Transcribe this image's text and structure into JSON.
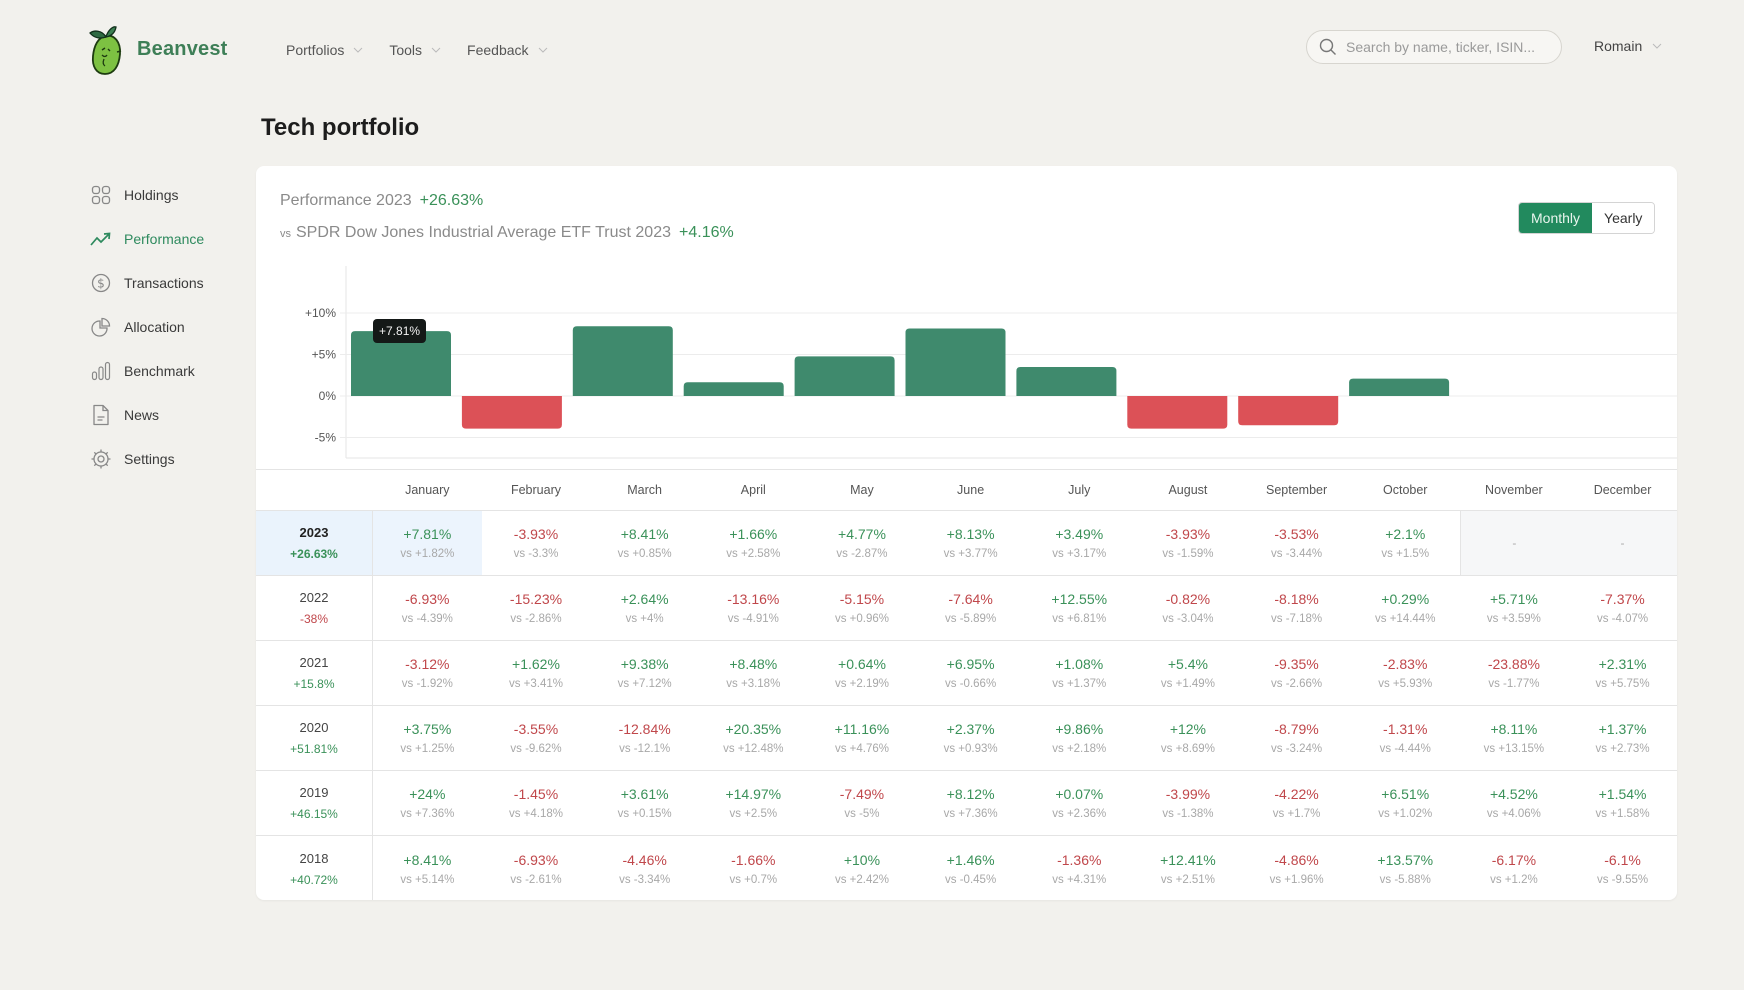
{
  "header": {
    "brand": "Beanvest",
    "nav": [
      {
        "label": "Portfolios"
      },
      {
        "label": "Tools"
      },
      {
        "label": "Feedback"
      }
    ],
    "search_placeholder": "Search by name, ticker, ISIN...",
    "user": "Romain"
  },
  "sidebar": {
    "items": [
      {
        "label": "Holdings",
        "icon": "grid-icon",
        "active": false
      },
      {
        "label": "Performance",
        "icon": "trending-up-icon",
        "active": true
      },
      {
        "label": "Transactions",
        "icon": "dollar-circle-icon",
        "active": false
      },
      {
        "label": "Allocation",
        "icon": "pie-chart-icon",
        "active": false
      },
      {
        "label": "Benchmark",
        "icon": "bar-chart-icon",
        "active": false
      },
      {
        "label": "News",
        "icon": "document-icon",
        "active": false
      },
      {
        "label": "Settings",
        "icon": "gear-icon",
        "active": false
      }
    ]
  },
  "page_title": "Tech portfolio",
  "summary": {
    "perf_label": "Performance 2023",
    "perf_value": "+26.63%",
    "vs_label": "vs",
    "benchmark_label": "SPDR Dow Jones Industrial Average ETF Trust 2023",
    "benchmark_value": "+4.16%"
  },
  "toggle": {
    "options": [
      "Monthly",
      "Yearly"
    ],
    "selected": "Monthly"
  },
  "colors": {
    "positive": "#3a9159",
    "negative": "#c0474b",
    "bar_positive": "#3f8a6d",
    "bar_negative": "#dc5157",
    "accent": "#228a5e"
  },
  "tooltip": {
    "month": "January",
    "text": "+7.81%"
  },
  "chart_data": {
    "type": "bar",
    "title": "Performance 2023",
    "categories": [
      "January",
      "February",
      "March",
      "April",
      "May",
      "June",
      "July",
      "August",
      "September",
      "October",
      "November",
      "December"
    ],
    "values": [
      7.81,
      -3.93,
      8.41,
      1.66,
      4.77,
      8.13,
      3.49,
      -3.93,
      -3.53,
      2.1,
      null,
      null
    ],
    "yticks": [
      "+10%",
      "+5%",
      "0%",
      "-5%"
    ],
    "ytick_values": [
      10,
      5,
      0,
      -5
    ],
    "ylim": [
      -7.5,
      12.5
    ],
    "xlabel": "",
    "ylabel": "",
    "grid": true,
    "legend": "none"
  },
  "table": {
    "months": [
      "January",
      "February",
      "March",
      "April",
      "May",
      "June",
      "July",
      "August",
      "September",
      "October",
      "November",
      "December"
    ],
    "rows": [
      {
        "year": "2023",
        "total": "+26.63%",
        "current": true,
        "cells": [
          {
            "v": "+7.81%",
            "b": "vs +1.82%"
          },
          {
            "v": "-3.93%",
            "b": "vs -3.3%"
          },
          {
            "v": "+8.41%",
            "b": "vs +0.85%"
          },
          {
            "v": "+1.66%",
            "b": "vs +2.58%"
          },
          {
            "v": "+4.77%",
            "b": "vs -2.87%"
          },
          {
            "v": "+8.13%",
            "b": "vs +3.77%"
          },
          {
            "v": "+3.49%",
            "b": "vs +3.17%"
          },
          {
            "v": "-3.93%",
            "b": "vs -1.59%"
          },
          {
            "v": "-3.53%",
            "b": "vs -3.44%"
          },
          {
            "v": "+2.1%",
            "b": "vs +1.5%"
          },
          {
            "v": "-",
            "b": null
          },
          {
            "v": "-",
            "b": null
          }
        ]
      },
      {
        "year": "2022",
        "total": "-38%",
        "current": false,
        "cells": [
          {
            "v": "-6.93%",
            "b": "vs -4.39%"
          },
          {
            "v": "-15.23%",
            "b": "vs -2.86%"
          },
          {
            "v": "+2.64%",
            "b": "vs +4%"
          },
          {
            "v": "-13.16%",
            "b": "vs -4.91%"
          },
          {
            "v": "-5.15%",
            "b": "vs +0.96%"
          },
          {
            "v": "-7.64%",
            "b": "vs -5.89%"
          },
          {
            "v": "+12.55%",
            "b": "vs +6.81%"
          },
          {
            "v": "-0.82%",
            "b": "vs -3.04%"
          },
          {
            "v": "-8.18%",
            "b": "vs -7.18%"
          },
          {
            "v": "+0.29%",
            "b": "vs +14.44%"
          },
          {
            "v": "+5.71%",
            "b": "vs +3.59%"
          },
          {
            "v": "-7.37%",
            "b": "vs -4.07%"
          }
        ]
      },
      {
        "year": "2021",
        "total": "+15.8%",
        "current": false,
        "cells": [
          {
            "v": "-3.12%",
            "b": "vs -1.92%"
          },
          {
            "v": "+1.62%",
            "b": "vs +3.41%"
          },
          {
            "v": "+9.38%",
            "b": "vs +7.12%"
          },
          {
            "v": "+8.48%",
            "b": "vs +3.18%"
          },
          {
            "v": "+0.64%",
            "b": "vs +2.19%"
          },
          {
            "v": "+6.95%",
            "b": "vs -0.66%"
          },
          {
            "v": "+1.08%",
            "b": "vs +1.37%"
          },
          {
            "v": "+5.4%",
            "b": "vs +1.49%"
          },
          {
            "v": "-9.35%",
            "b": "vs -2.66%"
          },
          {
            "v": "-2.83%",
            "b": "vs +5.93%"
          },
          {
            "v": "-23.88%",
            "b": "vs -1.77%"
          },
          {
            "v": "+2.31%",
            "b": "vs +5.75%"
          }
        ]
      },
      {
        "year": "2020",
        "total": "+51.81%",
        "current": false,
        "cells": [
          {
            "v": "+3.75%",
            "b": "vs +1.25%"
          },
          {
            "v": "-3.55%",
            "b": "vs -9.62%"
          },
          {
            "v": "-12.84%",
            "b": "vs -12.1%"
          },
          {
            "v": "+20.35%",
            "b": "vs +12.48%"
          },
          {
            "v": "+11.16%",
            "b": "vs +4.76%"
          },
          {
            "v": "+2.37%",
            "b": "vs +0.93%"
          },
          {
            "v": "+9.86%",
            "b": "vs +2.18%"
          },
          {
            "v": "+12%",
            "b": "vs +8.69%"
          },
          {
            "v": "-8.79%",
            "b": "vs -3.24%"
          },
          {
            "v": "-1.31%",
            "b": "vs -4.44%"
          },
          {
            "v": "+8.11%",
            "b": "vs +13.15%"
          },
          {
            "v": "+1.37%",
            "b": "vs +2.73%"
          }
        ]
      },
      {
        "year": "2019",
        "total": "+46.15%",
        "current": false,
        "cells": [
          {
            "v": "+24%",
            "b": "vs +7.36%"
          },
          {
            "v": "-1.45%",
            "b": "vs +4.18%"
          },
          {
            "v": "+3.61%",
            "b": "vs +0.15%"
          },
          {
            "v": "+14.97%",
            "b": "vs +2.5%"
          },
          {
            "v": "-7.49%",
            "b": "vs -5%"
          },
          {
            "v": "+8.12%",
            "b": "vs +7.36%"
          },
          {
            "v": "+0.07%",
            "b": "vs +2.36%"
          },
          {
            "v": "-3.99%",
            "b": "vs -1.38%"
          },
          {
            "v": "-4.22%",
            "b": "vs +1.7%"
          },
          {
            "v": "+6.51%",
            "b": "vs +1.02%"
          },
          {
            "v": "+4.52%",
            "b": "vs +4.06%"
          },
          {
            "v": "+1.54%",
            "b": "vs +1.58%"
          }
        ]
      },
      {
        "year": "2018",
        "total": "+40.72%",
        "current": false,
        "cells": [
          {
            "v": "+8.41%",
            "b": "vs +5.14%"
          },
          {
            "v": "-6.93%",
            "b": "vs -2.61%"
          },
          {
            "v": "-4.46%",
            "b": "vs -3.34%"
          },
          {
            "v": "-1.66%",
            "b": "vs +0.7%"
          },
          {
            "v": "+10%",
            "b": "vs +2.42%"
          },
          {
            "v": "+1.46%",
            "b": "vs -0.45%"
          },
          {
            "v": "-1.36%",
            "b": "vs +4.31%"
          },
          {
            "v": "+12.41%",
            "b": "vs +2.51%"
          },
          {
            "v": "-4.86%",
            "b": "vs +1.96%"
          },
          {
            "v": "+13.57%",
            "b": "vs -5.88%"
          },
          {
            "v": "-6.17%",
            "b": "vs +1.2%"
          },
          {
            "v": "-6.1%",
            "b": "vs -9.55%"
          }
        ]
      }
    ]
  }
}
